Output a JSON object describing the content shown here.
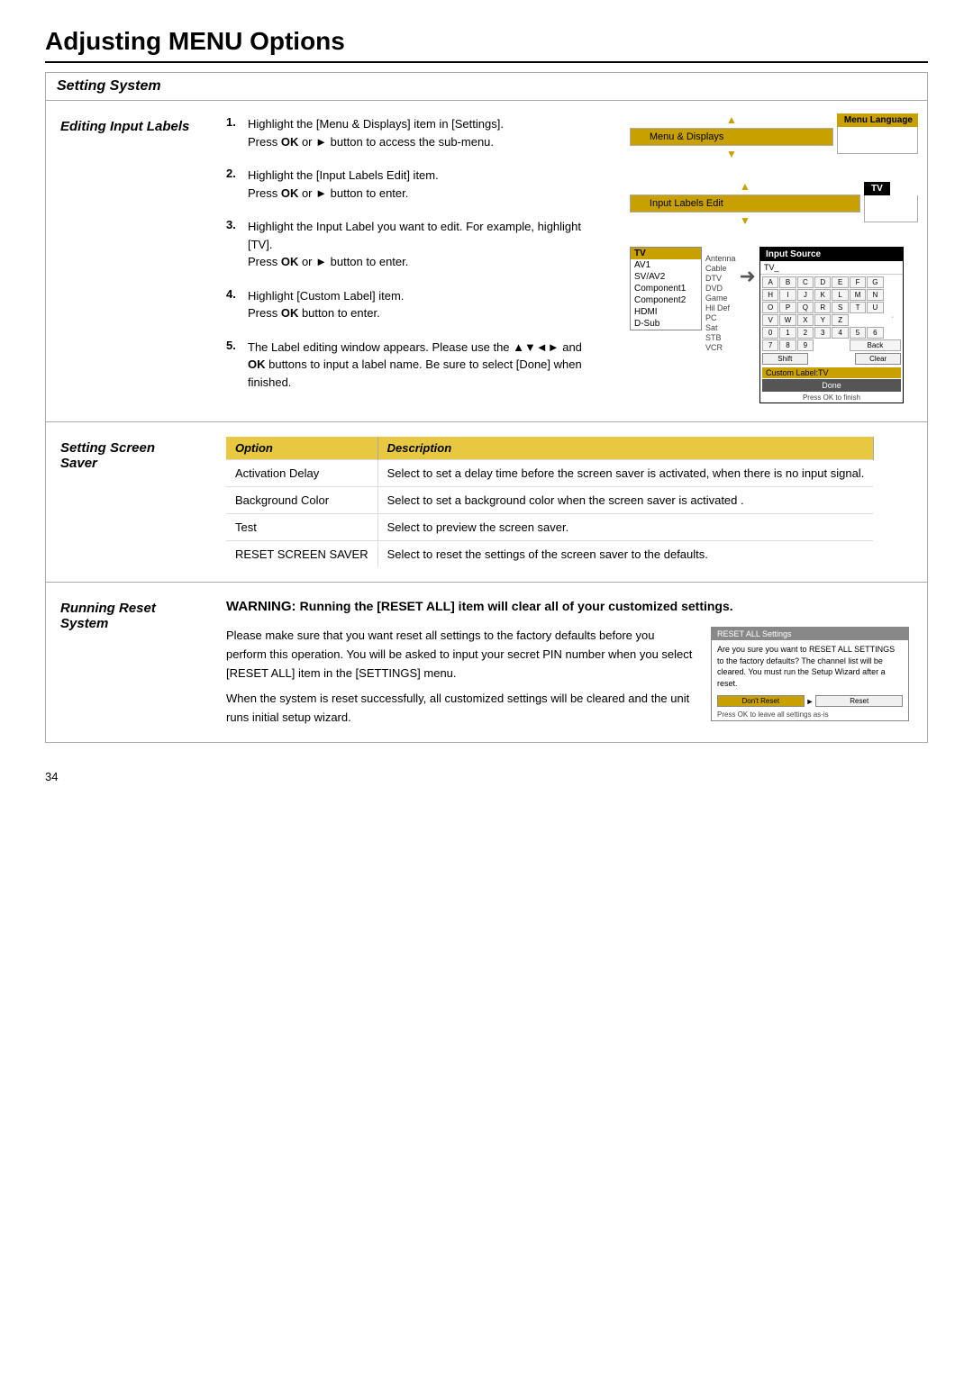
{
  "page": {
    "title": "Adjusting MENU Options",
    "page_number": "34"
  },
  "setting_system": {
    "header": "Setting System"
  },
  "editing_input_labels": {
    "label": "Editing Input Labels",
    "steps": [
      {
        "num": "1.",
        "text": "Highlight the [Menu & Displays] item in [Settings]. Press OK or ► button to access the sub-menu."
      },
      {
        "num": "2.",
        "text": "Highlight the [Input Labels Edit] item. Press OK or ► button to enter."
      },
      {
        "num": "3.",
        "text": "Highlight the Input Label you want to edit. For example, highlight [TV]. Press OK or ► button to enter."
      },
      {
        "num": "4.",
        "text": "Highlight [Custom Label] item. Press OK button to enter."
      },
      {
        "num": "5.",
        "text": "The Label editing window appears. Please use the ▲▼◄► and OK buttons to input a label name. Be sure to select [Done] when finished."
      }
    ],
    "diagram1": {
      "header": "Menu Language",
      "selected_item": "Menu & Displays"
    },
    "diagram2": {
      "header": "TV",
      "selected_item": "Input Labels Edit"
    },
    "diagram3": {
      "input_list": [
        "TV",
        "AV1",
        "SV/AV2",
        "Component1",
        "Component2",
        "HDMI",
        "D-Sub"
      ],
      "antenna_labels": [
        "Antenna",
        "Cable",
        "DTV",
        "DVD",
        "Game",
        "Hil Def",
        "PC",
        "Sat",
        "STB",
        "VCR"
      ],
      "input_source_title": "Input Source",
      "tv_input_display": "TV_",
      "kbd_row1": [
        "A",
        "B",
        "C",
        "D",
        "E",
        "F",
        "G"
      ],
      "kbd_row2": [
        "H",
        "I",
        "J",
        "K",
        "L",
        "M",
        "N"
      ],
      "kbd_row3": [
        "O",
        "P",
        "Q",
        "R",
        "S",
        "T",
        "U"
      ],
      "kbd_row4": [
        "V",
        "W",
        "X",
        "Y",
        "Z",
        "",
        ""
      ],
      "kbd_row5": [
        "0",
        "1",
        "2",
        "3",
        "4",
        "5",
        "6"
      ],
      "kbd_row6": [
        "7",
        "8",
        "9",
        "",
        "",
        "Back"
      ],
      "shift_label": "Shift",
      "clear_label": "Clear",
      "custom_label": "Custom Label:TV",
      "done_label": "Done",
      "press_ok_finish": "Press OK to finish"
    }
  },
  "setting_screen_saver": {
    "label": "Setting Screen Saver",
    "table_headers": [
      "Option",
      "Description"
    ],
    "table_rows": [
      {
        "option": "Activation Delay",
        "description": "Select to set a delay time before the screen saver is activated, when there is no input signal."
      },
      {
        "option": "Background Color",
        "description": "Select to set a background color when the screen saver is activated."
      },
      {
        "option": "Test",
        "description": "Select to preview the screen saver."
      },
      {
        "option": "RESET SCREEN SAVER",
        "description": "Select to reset the settings of the screen saver to the defaults."
      }
    ]
  },
  "running_reset_system": {
    "label": "Running Reset System",
    "warning_heading": "WARNING: Running the [RESET ALL] item will clear all of your customized settings.",
    "body_text": "Please make sure that you want reset all settings to the factory defaults before you perform this operation. You will be asked to input your secret PIN number when you select [RESET ALL] item in the [SETTINGS] menu.\nWhen the system is reset successfully, all customized settings will be cleared and the unit runs initial setup wizard.",
    "dialog": {
      "header": "RESET ALL Settings",
      "body": "Are you sure you want to RESET ALL SETTINGS to the factory defaults? The channel list will be cleared. You must run the Setup Wizard after a reset.",
      "dont_reset": "Don't Reset",
      "reset": "Reset",
      "press_ok": "Press OK to leave all settings as-is"
    }
  }
}
